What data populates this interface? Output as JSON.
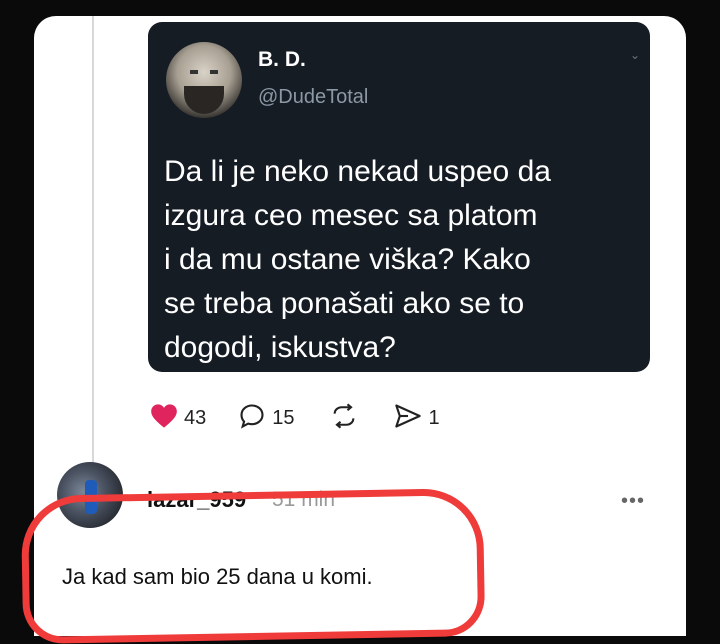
{
  "tweet": {
    "author_name": "B. D.",
    "author_handle": "@DudeTotal",
    "text": "Da li je neko nekad uspeo da\nizgura ceo mesec sa platom\ni da mu ostane viška? Kako\nse treba ponašati ako se to\ndogodi, iskustva?"
  },
  "actions": {
    "likes": "43",
    "comments": "15",
    "shares": "1",
    "like_color": "#e0245e"
  },
  "reply": {
    "username": "lazar_959",
    "time": "51 min",
    "text": "Ja kad sam bio 25 dana u komi."
  },
  "icons": [
    "heart-icon",
    "comment-icon",
    "repost-icon",
    "share-icon",
    "more-icon"
  ],
  "highlight_color": "#f03b3b"
}
